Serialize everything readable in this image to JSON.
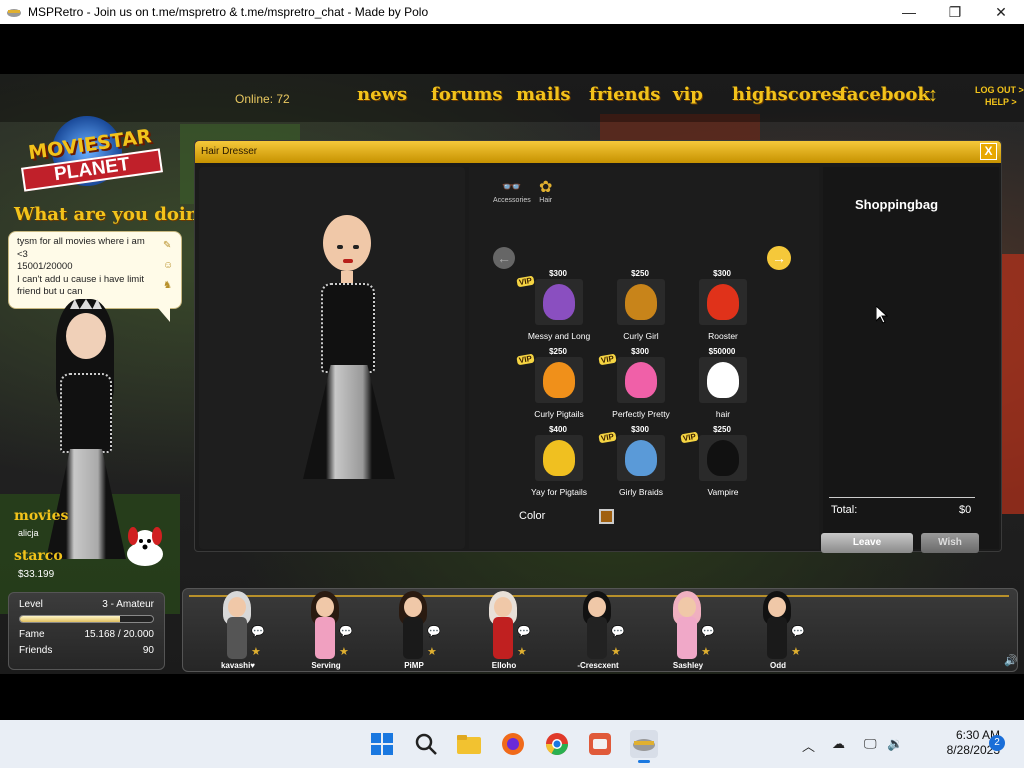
{
  "window": {
    "title": "MSPRetro - Join us on t.me/mspretro & t.me/mspretro_chat - Made by Polo"
  },
  "topnav": {
    "online": "Online: 72",
    "items": [
      "news",
      "forums",
      "mails",
      "friends",
      "vip",
      "highscores",
      "facebook"
    ],
    "logout": "LOG OUT >",
    "help": "HELP >"
  },
  "logo": {
    "line1": "MOVIESTAR",
    "line2": "PLANET"
  },
  "status": {
    "prompt": "What are you doing?",
    "bubble_lines": [
      "tysm for all movies where i am <3",
      "15001/20000",
      "I can't add u cause i have limit friend but u can"
    ]
  },
  "player": {
    "name": "movies",
    "username": "alicja",
    "starcoins_label": "starco",
    "starcoins": "$33.199",
    "level_label": "Level",
    "level": "3 - Amateur",
    "level_progress": 0.75,
    "fame_label": "Fame",
    "fame": "15.168 / 20.000",
    "friends_label": "Friends",
    "friends": "90"
  },
  "hairdresser": {
    "title": "Hair Dresser",
    "close": "X",
    "categories": [
      "Accessories",
      "Hair"
    ],
    "items": [
      {
        "name": "Messy and Long",
        "price": "$300",
        "vip": true,
        "color": "#8a4fc0"
      },
      {
        "name": "Curly Girl",
        "price": "$250",
        "vip": false,
        "color": "#c8841a"
      },
      {
        "name": "Rooster",
        "price": "$300",
        "vip": false,
        "color": "#e0321a"
      },
      {
        "name": "Curly Pigtails",
        "price": "$250",
        "vip": true,
        "color": "#f0901a"
      },
      {
        "name": "Perfectly Pretty",
        "price": "$300",
        "vip": true,
        "color": "#f060a8"
      },
      {
        "name": "hair",
        "price": "$50000",
        "vip": false,
        "color": "#ffffff"
      },
      {
        "name": "Yay for Pigtails",
        "price": "$400",
        "vip": false,
        "color": "#f0c020"
      },
      {
        "name": "Girly Braids",
        "price": "$300",
        "vip": true,
        "color": "#5a9ad8"
      },
      {
        "name": "Vampire",
        "price": "$250",
        "vip": true,
        "color": "#111111"
      }
    ],
    "vip_label": "VIP",
    "color_label": "Color",
    "bag_title": "Shoppingbag",
    "total_label": "Total:",
    "total": "$0",
    "leave": "Leave",
    "wish": "Wish"
  },
  "friends_bar": [
    {
      "name": "kavashi♥",
      "hair": "#d8d8d8",
      "outfit": "#555"
    },
    {
      "name": "Serving",
      "hair": "#2a1a10",
      "outfit": "#f0a0c0"
    },
    {
      "name": "PiMP",
      "hair": "#2a1a10",
      "outfit": "#1a1a1a"
    },
    {
      "name": "Elloho",
      "hair": "#e8e0d8",
      "outfit": "#c02020"
    },
    {
      "name": "-Crescxent",
      "hair": "#111",
      "outfit": "#222"
    },
    {
      "name": "Sashley",
      "hair": "#f0b0c0",
      "outfit": "#f0a8c8"
    },
    {
      "name": "Odd",
      "hair": "#111",
      "outfit": "#1a1a1a"
    }
  ],
  "taskbar": {
    "time": "6:30 AM",
    "date": "8/28/2023",
    "notifications": "2"
  }
}
